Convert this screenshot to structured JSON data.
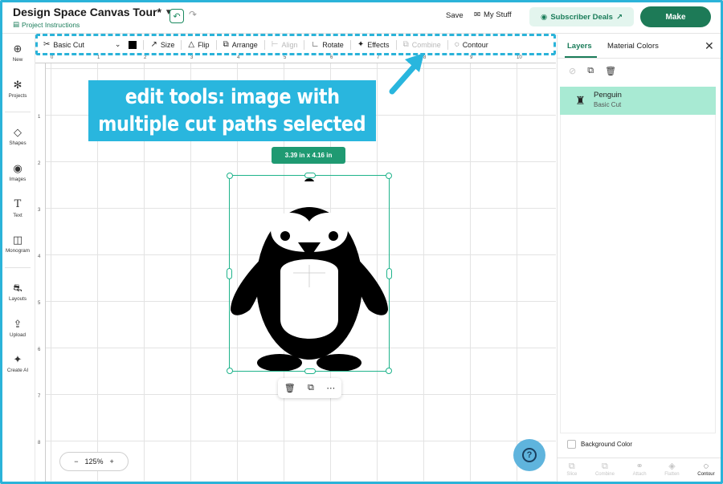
{
  "header": {
    "title": "Design Space Canvas Tour*",
    "project_instructions": "Project Instructions",
    "save": "Save",
    "my_stuff": "My Stuff",
    "subscriber_deals": "Subscriber Deals",
    "make": "Make"
  },
  "toolbar": {
    "operation": "Basic Cut",
    "size": "Size",
    "flip": "Flip",
    "arrange": "Arrange",
    "align": "Align",
    "rotate": "Rotate",
    "effects": "Effects",
    "combine": "Combine",
    "contour": "Contour",
    "swatch_color": "#000000"
  },
  "sidebar": {
    "items": [
      {
        "label": "New",
        "icon": "plus-circle-icon"
      },
      {
        "label": "Projects",
        "icon": "projects-icon"
      },
      {
        "label": "Shapes",
        "icon": "shapes-icon"
      },
      {
        "label": "Images",
        "icon": "images-icon"
      },
      {
        "label": "Text",
        "icon": "text-icon"
      },
      {
        "label": "Monogram",
        "icon": "monogram-icon"
      },
      {
        "label": "Layouts",
        "icon": "layouts-icon"
      },
      {
        "label": "Upload",
        "icon": "upload-icon"
      },
      {
        "label": "Create AI",
        "icon": "sparkle-icon"
      }
    ]
  },
  "canvas": {
    "callout_line1": "edit tools: image with",
    "callout_line2": "multiple cut paths selected",
    "dimensions": "3.39 in x 4.16 in",
    "zoom": "125%",
    "ruler_top": [
      "0",
      "1",
      "2",
      "3",
      "4",
      "5",
      "6",
      "7",
      "8",
      "9",
      "10"
    ],
    "ruler_left": [
      "1",
      "2",
      "3",
      "4",
      "5",
      "6",
      "7",
      "8"
    ]
  },
  "right_panel": {
    "tabs": [
      "Layers",
      "Material Colors"
    ],
    "layer_name": "Penguin",
    "layer_operation": "Basic Cut",
    "background_color": "Background Color",
    "bottom_actions": [
      "Slice",
      "Combine",
      "Attach",
      "Flatten",
      "Contour"
    ]
  },
  "colors": {
    "accent": "#1b7d5a",
    "callout": "#29b6de",
    "selection": "#1fb38b",
    "layer_highlight": "#a8ead3"
  }
}
